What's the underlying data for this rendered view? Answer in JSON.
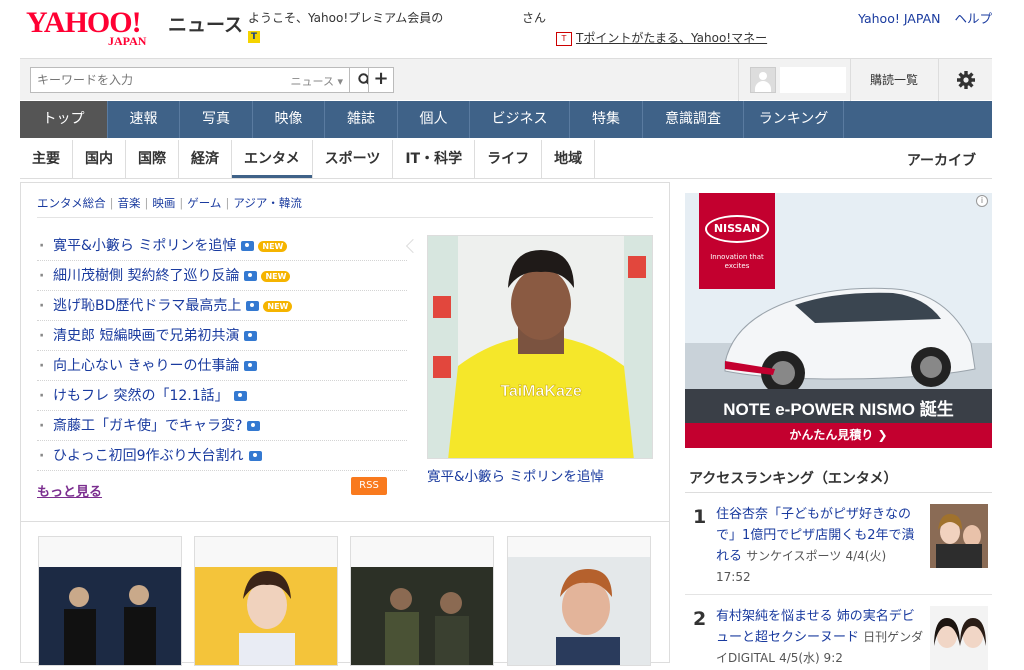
{
  "header": {
    "logo_text": "YAHOO!",
    "logo_sub": "JAPAN",
    "service_name": "ニュース",
    "welcome": "ようこそ、Yahoo!プレミアム会員の",
    "welcome_suffix": "さん",
    "tpoint_icon": "T",
    "promo_icon": "T",
    "promo": "Tポイントがたまる、Yahoo!マネー",
    "links": [
      "Yahoo! JAPAN",
      "ヘルプ"
    ]
  },
  "search": {
    "placeholder": "キーワードを入力",
    "scope": "ニュース ▾",
    "search_icon": "search-icon",
    "plus_label": "+",
    "subscribe_label": "購読一覧",
    "gear_icon": "gear-icon"
  },
  "nav": {
    "items": [
      "トップ",
      "速報",
      "写真",
      "映像",
      "雑誌",
      "個人",
      "ビジネス",
      "特集",
      "意識調査",
      "ランキング"
    ],
    "active": "トップ"
  },
  "subnav": {
    "items": [
      "主要",
      "国内",
      "国際",
      "経済",
      "エンタメ",
      "スポーツ",
      "IT・科学",
      "ライフ",
      "地域"
    ],
    "active": "エンタメ",
    "archive": "アーカイブ"
  },
  "categories": [
    "エンタメ総合",
    "音楽",
    "映画",
    "ゲーム",
    "アジア・韓流"
  ],
  "news": [
    {
      "title": "寛平&小籔ら ミポリンを追悼",
      "camera": true,
      "new": true
    },
    {
      "title": "細川茂樹側 契約終了巡り反論",
      "camera": true,
      "new": true
    },
    {
      "title": "逃げ恥BD歴代ドラマ最高売上",
      "camera": true,
      "new": true
    },
    {
      "title": "清史郎 短編映画で兄弟初共演",
      "camera": true,
      "new": false
    },
    {
      "title": "向上心ない きゃりーの仕事論",
      "camera": true,
      "new": false
    },
    {
      "title": "けもフレ 突然の「12.1話」",
      "camera": true,
      "new": false
    },
    {
      "title": "斎藤工「ガキ使」でキャラ変?",
      "camera": true,
      "new": false
    },
    {
      "title": "ひよっこ初回9作ぶり大台割れ",
      "camera": true,
      "new": false
    }
  ],
  "new_badge": "NEW",
  "more_label": "もっと見る",
  "rss_label": "RSS",
  "feature_caption": "寛平&小籔ら ミポリンを追悼",
  "ad": {
    "brand": "NISSAN",
    "tagline": "Innovation that excites",
    "headline": "NOTE e-POWER NISMO 誕生",
    "cta": "かんたん見積り ❯",
    "info_icon": "i"
  },
  "ranking": {
    "title": "アクセスランキング（エンタメ）",
    "items": [
      {
        "rank": "1",
        "title": "住谷杏奈「子どもがピザ好きなので」1億円でピザ店開くも2年で潰れる",
        "source": "サンケイスポーツ",
        "date": "4/4(火) 17:52"
      },
      {
        "rank": "2",
        "title": "有村架純を悩ませる 姉の実名デビューと超セクシーヌード",
        "source": "日刊ゲンダイDIGITAL",
        "date": "4/5(水) 9:2"
      }
    ]
  },
  "colors": {
    "nav_bg": "#3f6288",
    "link": "#1a3b9f",
    "brand_red": "#ff0033",
    "rss": "#f97a1e",
    "new_badge": "#f5b400"
  }
}
